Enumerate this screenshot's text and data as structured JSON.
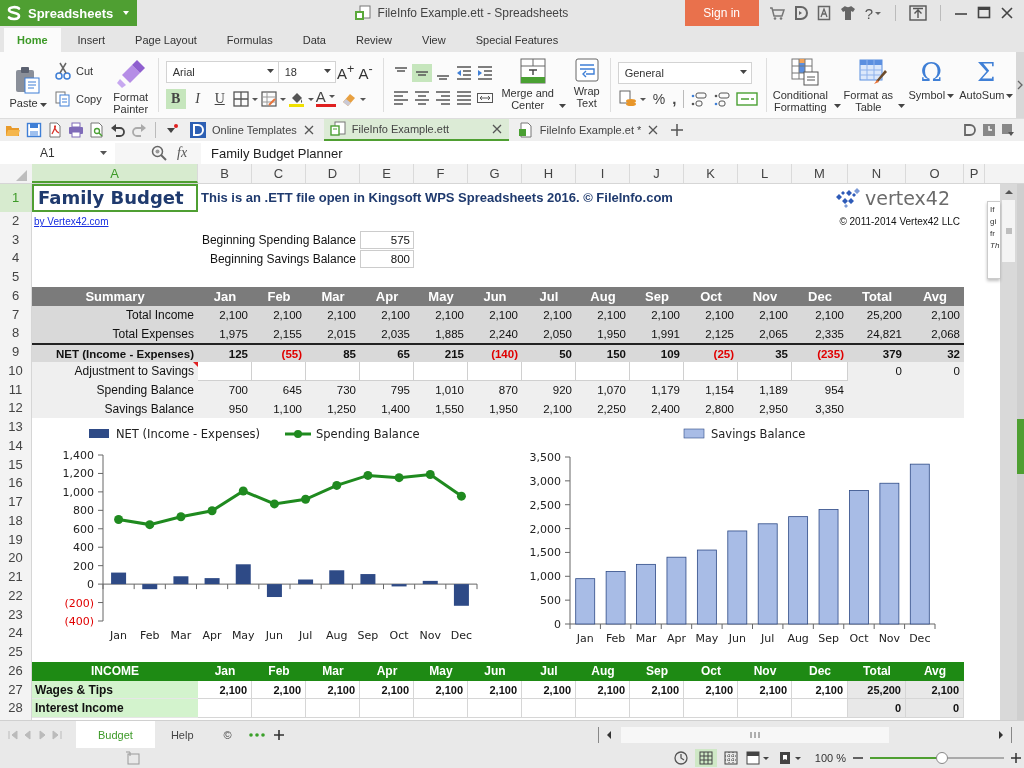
{
  "app": {
    "name": "Spreadsheets"
  },
  "window": {
    "title": "FileInfo Example.ett - Spreadsheets",
    "sign_in": "Sign in",
    "help": "?"
  },
  "menu_tabs": [
    {
      "label": "Home",
      "selected": true
    },
    {
      "label": "Insert",
      "selected": false
    },
    {
      "label": "Page Layout",
      "selected": false
    },
    {
      "label": "Formulas",
      "selected": false
    },
    {
      "label": "Data",
      "selected": false
    },
    {
      "label": "Review",
      "selected": false
    },
    {
      "label": "View",
      "selected": false
    },
    {
      "label": "Special Features",
      "selected": false
    }
  ],
  "ribbon": {
    "paste": "Paste",
    "cut": "Cut",
    "copy": "Copy",
    "format_painter": "Format Painter",
    "font": "Arial",
    "font_size": "18",
    "size_buttons": [
      "A$^{+}$",
      "A$^{-}$"
    ],
    "format_buttons": [
      {
        "label": "B",
        "on": true
      },
      {
        "label": "I",
        "on": false
      },
      {
        "label": "U",
        "on": false
      }
    ],
    "font_color_label": "A",
    "vertical_align": [
      {
        "selected": false
      },
      {
        "selected": true
      },
      {
        "selected": false
      }
    ],
    "merge": "Merge and Center",
    "wrap": "Wrap Text",
    "number_format": "General",
    "number_symbols": [
      "%",
      ","
    ],
    "conditional": "Conditional Formatting",
    "format_table": "Format as Table",
    "symbol": {
      "glyph": "Ω",
      "label": "Symbol"
    },
    "autosum": {
      "glyph": "Σ",
      "label": "AutoSum"
    }
  },
  "doc_tabs": [
    {
      "label": "Online Templates",
      "selected": false,
      "kind": "templates"
    },
    {
      "label": "FileInfo Example.ett",
      "selected": true,
      "kind": "template"
    },
    {
      "label": "FileInfo Example.et *",
      "selected": false,
      "kind": "sheet"
    }
  ],
  "formula_bar": {
    "cell": "A1",
    "fx": "fx",
    "formula": "Family Budget Planner"
  },
  "sheet": {
    "columns": [
      {
        "label": "A",
        "selected": true
      },
      {
        "label": "B",
        "selected": false
      },
      {
        "label": "C",
        "selected": false
      },
      {
        "label": "D",
        "selected": false
      },
      {
        "label": "E",
        "selected": false
      },
      {
        "label": "F",
        "selected": false
      },
      {
        "label": "G",
        "selected": false
      },
      {
        "label": "H",
        "selected": false
      },
      {
        "label": "I",
        "selected": false
      },
      {
        "label": "J",
        "selected": false
      },
      {
        "label": "K",
        "selected": false
      },
      {
        "label": "L",
        "selected": false
      },
      {
        "label": "M",
        "selected": false
      },
      {
        "label": "N",
        "selected": false
      },
      {
        "label": "O",
        "selected": false
      },
      {
        "label": "P",
        "selected": false
      }
    ],
    "rows": [
      {
        "label": "1",
        "selected": true
      },
      {
        "label": "2",
        "selected": false
      },
      {
        "label": "3",
        "selected": false
      },
      {
        "label": "4",
        "selected": false
      },
      {
        "label": "5",
        "selected": false
      },
      {
        "label": "6",
        "selected": false
      },
      {
        "label": "7",
        "selected": false
      },
      {
        "label": "8",
        "selected": false
      },
      {
        "label": "9",
        "selected": false
      },
      {
        "label": "10",
        "selected": false
      },
      {
        "label": "11",
        "selected": false
      },
      {
        "label": "12",
        "selected": false
      },
      {
        "label": "13",
        "selected": false
      },
      {
        "label": "14",
        "selected": false
      },
      {
        "label": "15",
        "selected": false
      },
      {
        "label": "16",
        "selected": false
      },
      {
        "label": "17",
        "selected": false
      },
      {
        "label": "18",
        "selected": false
      },
      {
        "label": "19",
        "selected": false
      },
      {
        "label": "20",
        "selected": false
      },
      {
        "label": "21",
        "selected": false
      },
      {
        "label": "22",
        "selected": false
      },
      {
        "label": "23",
        "selected": false
      },
      {
        "label": "24",
        "selected": false
      },
      {
        "label": "25",
        "selected": false
      },
      {
        "label": "26",
        "selected": false
      },
      {
        "label": "27",
        "selected": false
      },
      {
        "label": "28",
        "selected": false
      }
    ],
    "title": "Family Budget",
    "subtitle": "This is an .ETT file open in Kingsoft WPS Spreadsheets 2016. © FileInfo.com",
    "logo": "vertex42",
    "byline": "by Vertex42.com",
    "copyright": "© 2011-2014 Vertex42 LLC",
    "balances": [
      {
        "label": "Beginning Spending Balance",
        "value": "575"
      },
      {
        "label": "Beginning Savings Balance",
        "value": "800"
      }
    ],
    "summary": {
      "header": [
        "Summary",
        "Jan",
        "Feb",
        "Mar",
        "Apr",
        "May",
        "Jun",
        "Jul",
        "Aug",
        "Sep",
        "Oct",
        "Nov",
        "Dec",
        "Total",
        "Avg"
      ],
      "rows": [
        {
          "label": "Total Income",
          "kind": "value",
          "shaded": true,
          "cells": [
            "2,100",
            "2,100",
            "2,100",
            "2,100",
            "2,100",
            "2,100",
            "2,100",
            "2,100",
            "2,100",
            "2,100",
            "2,100",
            "2,100",
            "25,200",
            "2,100"
          ]
        },
        {
          "label": "Total Expenses",
          "kind": "value",
          "shaded": true,
          "cells": [
            "1,975",
            "2,155",
            "2,015",
            "2,035",
            "1,885",
            "2,240",
            "2,050",
            "1,950",
            "1,991",
            "2,125",
            "2,065",
            "2,335",
            "24,821",
            "2,068"
          ]
        },
        {
          "label": "NET (Income - Expenses)",
          "kind": "net",
          "shaded": true,
          "cells": [
            {
              "v": "125",
              "negative": false
            },
            {
              "v": "(55)",
              "negative": true
            },
            {
              "v": "85",
              "negative": false
            },
            {
              "v": "65",
              "negative": false
            },
            {
              "v": "215",
              "negative": false
            },
            {
              "v": "(140)",
              "negative": true
            },
            {
              "v": "50",
              "negative": false
            },
            {
              "v": "150",
              "negative": false
            },
            {
              "v": "109",
              "negative": false
            },
            {
              "v": "(25)",
              "negative": true
            },
            {
              "v": "35",
              "negative": false
            },
            {
              "v": "(235)",
              "negative": true
            },
            {
              "v": "379",
              "negative": false
            },
            {
              "v": "32",
              "negative": false
            }
          ]
        },
        {
          "label": "Adjustment to Savings",
          "kind": "input",
          "shaded": false,
          "has_comment": true,
          "totals": [
            "0",
            "0"
          ]
        },
        {
          "label": "Spending Balance",
          "kind": "value",
          "shaded": false,
          "cells": [
            "700",
            "645",
            "730",
            "795",
            "1,010",
            "870",
            "920",
            "1,070",
            "1,179",
            "1,154",
            "1,189",
            "954"
          ]
        },
        {
          "label": "Savings Balance",
          "kind": "value",
          "shaded": false,
          "cells": [
            "950",
            "1,100",
            "1,250",
            "1,400",
            "1,550",
            "1,950",
            "2,100",
            "2,250",
            "2,400",
            "2,800",
            "2,950",
            "3,350"
          ]
        }
      ]
    },
    "charts": [
      {
        "chart_data": {
          "type": "bar",
          "categories": [
            "Jan",
            "Feb",
            "Mar",
            "Apr",
            "May",
            "Jun",
            "Jul",
            "Aug",
            "Sep",
            "Oct",
            "Nov",
            "Dec"
          ],
          "series": [
            {
              "name": "NET (Income - Expenses)",
              "type": "bar",
              "color": "#2e4a86",
              "values": [
                125,
                -55,
                85,
                65,
                215,
                -140,
                50,
                150,
                109,
                -25,
                35,
                -235
              ]
            },
            {
              "name": "Spending Balance",
              "type": "line",
              "color": "#1f8a1f",
              "marker": "circle",
              "values": [
                700,
                645,
                730,
                795,
                1010,
                870,
                920,
                1070,
                1179,
                1154,
                1189,
                954
              ]
            }
          ],
          "legend": "top",
          "ylim": [
            -400,
            1400
          ],
          "yticks": [
            {
              "value": -400,
              "label": "(400)"
            },
            {
              "value": -200,
              "label": "(200)"
            },
            {
              "value": 0,
              "label": "0"
            },
            {
              "value": 200,
              "label": "200"
            },
            {
              "value": 400,
              "label": "400"
            },
            {
              "value": 600,
              "label": "600"
            },
            {
              "value": 800,
              "label": "800"
            },
            {
              "value": 1000,
              "label": "1,000"
            },
            {
              "value": 1200,
              "label": "1,200"
            },
            {
              "value": 1400,
              "label": "1,400"
            }
          ]
        }
      },
      {
        "chart_data": {
          "type": "bar",
          "categories": [
            "Jan",
            "Feb",
            "Mar",
            "Apr",
            "May",
            "Jun",
            "Jul",
            "Aug",
            "Sep",
            "Oct",
            "Nov",
            "Dec"
          ],
          "series": [
            {
              "name": "Savings Balance",
              "color": "#a8bce6",
              "values": [
                950,
                1100,
                1250,
                1400,
                1550,
                1950,
                2100,
                2250,
                2400,
                2800,
                2950,
                3350
              ]
            }
          ],
          "legend": "top",
          "ylim": [
            0,
            3500
          ],
          "yticks": [
            {
              "value": 0,
              "label": "0"
            },
            {
              "value": 500,
              "label": "500"
            },
            {
              "value": 1000,
              "label": "1,000"
            },
            {
              "value": 1500,
              "label": "1,500"
            },
            {
              "value": 2000,
              "label": "2,000"
            },
            {
              "value": 2500,
              "label": "2,500"
            },
            {
              "value": 3000,
              "label": "3,000"
            },
            {
              "value": 3500,
              "label": "3,500"
            }
          ]
        }
      }
    ],
    "income": {
      "header": [
        "INCOME",
        "Jan",
        "Feb",
        "Mar",
        "Apr",
        "May",
        "Jun",
        "Jul",
        "Aug",
        "Sep",
        "Oct",
        "Nov",
        "Dec",
        "Total",
        "Avg"
      ],
      "rows": [
        {
          "label": "Wages & Tips",
          "kind": "value",
          "cells": [
            "2,100",
            "2,100",
            "2,100",
            "2,100",
            "2,100",
            "2,100",
            "2,100",
            "2,100",
            "2,100",
            "2,100",
            "2,100",
            "2,100",
            "25,200",
            "2,100"
          ]
        },
        {
          "label": "Interest Income",
          "kind": "input",
          "totals": [
            "0",
            "0"
          ]
        }
      ]
    }
  },
  "side_note": [
    "If",
    "gi",
    "fr",
    "Th"
  ],
  "sheet_tabs": [
    {
      "label": "Budget",
      "selected": true
    },
    {
      "label": "Help",
      "selected": false
    },
    {
      "label": "©",
      "selected": false
    }
  ],
  "status": {
    "zoom": "100 %",
    "zoom_slider": {
      "level": 0.54
    }
  }
}
